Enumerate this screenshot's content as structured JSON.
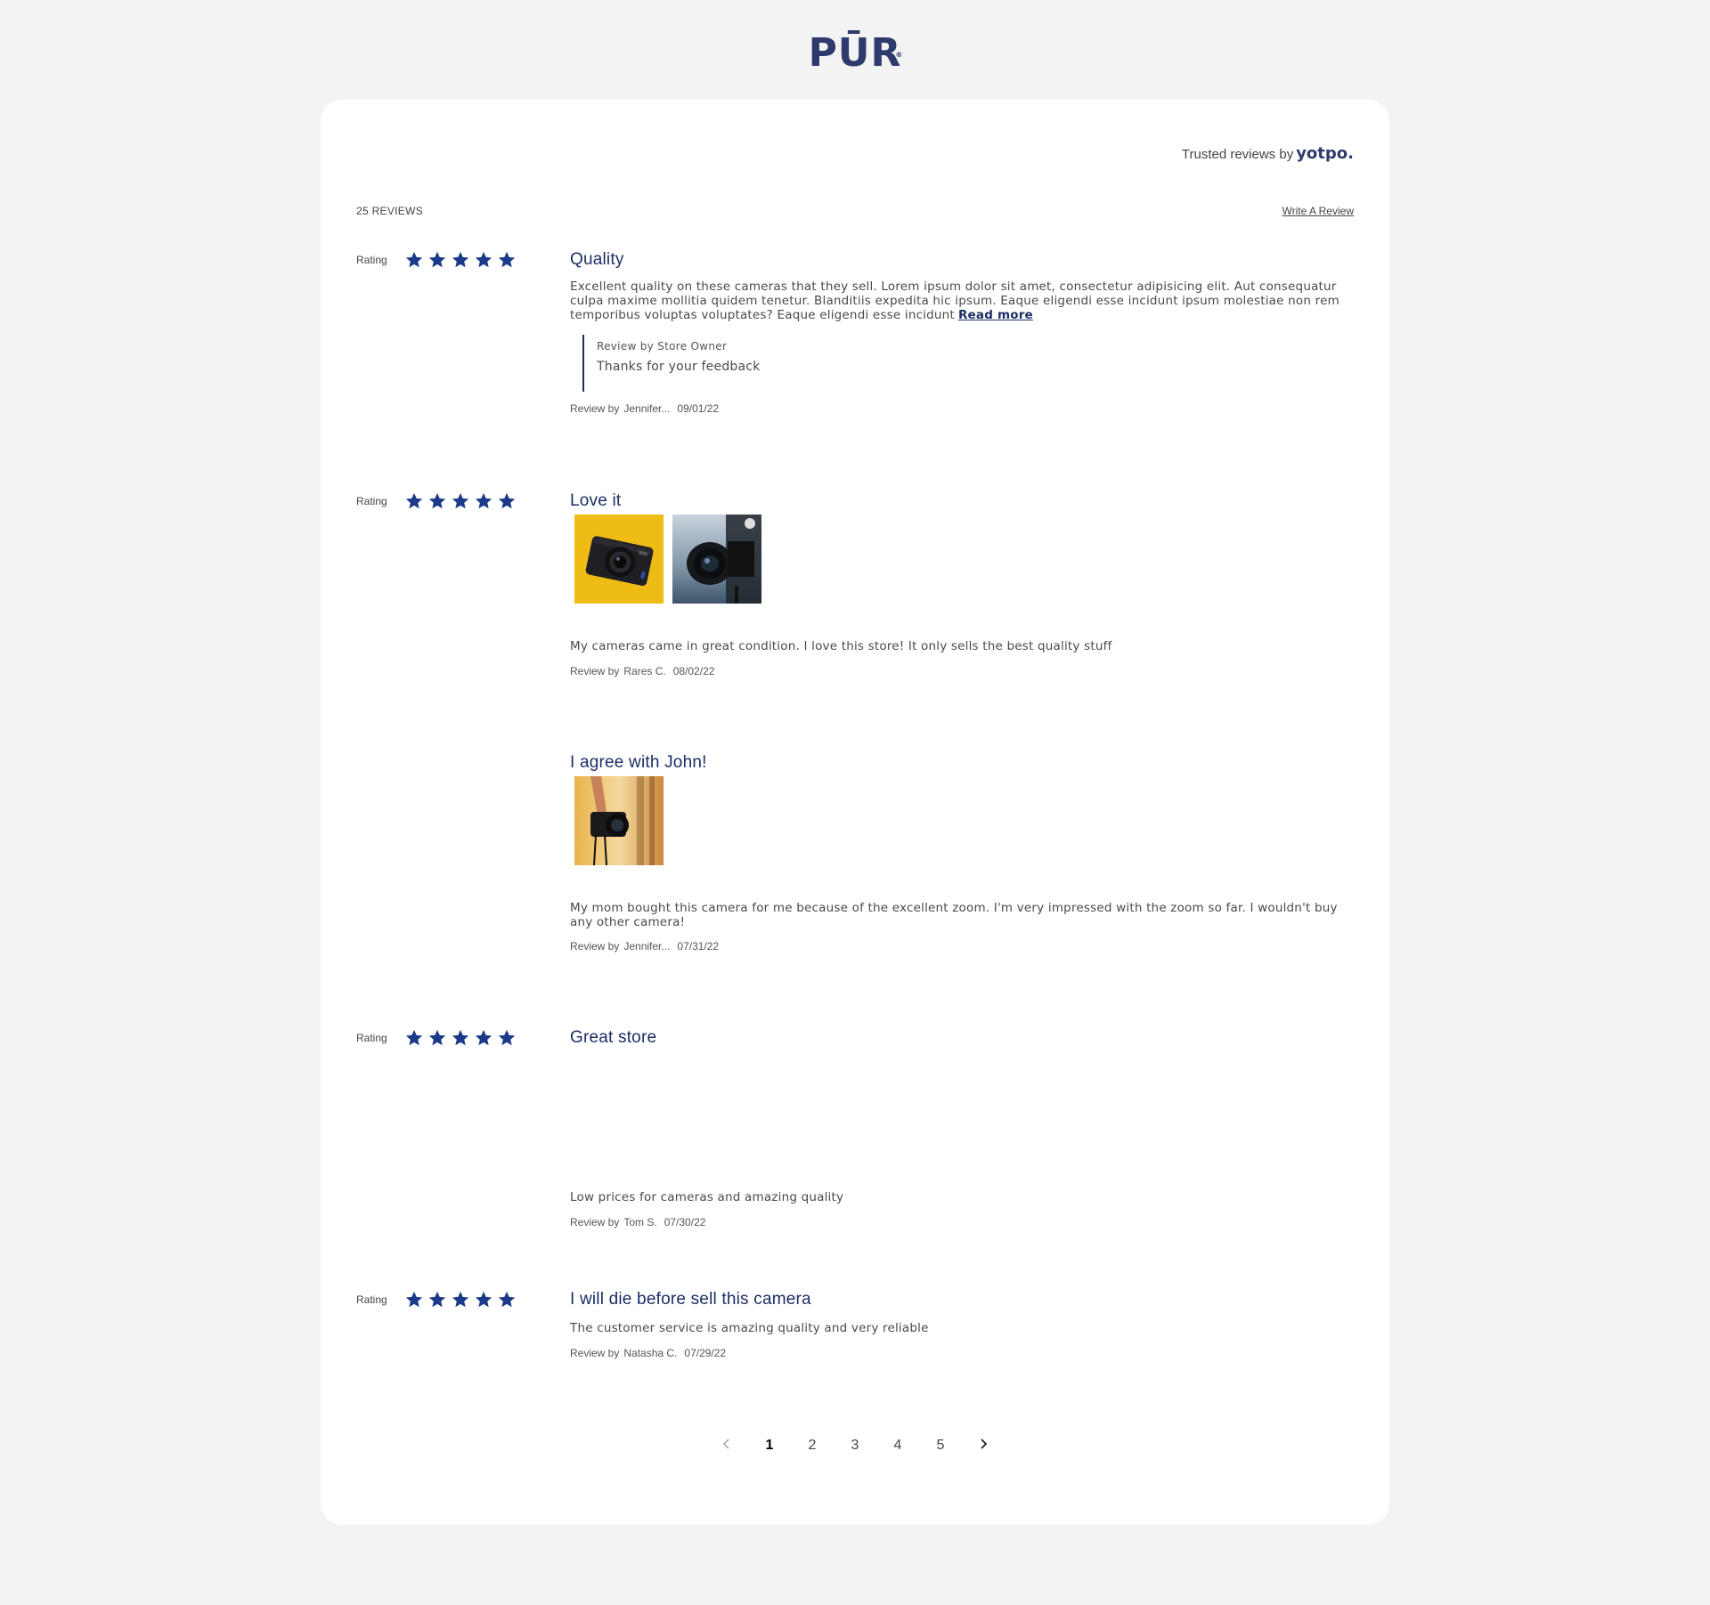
{
  "brand": {
    "logo_text": "PŪR",
    "logo_mark": "®"
  },
  "header": {
    "trusted_prefix": "Trusted reviews by",
    "trusted_brand": "yotpo.",
    "review_count": "25 REVIEWS",
    "write_review": "Write A Review"
  },
  "rating_label": "Rating",
  "accent_color": "#1c3a8a",
  "reviews": [
    {
      "stars": 5,
      "title": "Quality",
      "body": "Excellent quality on these cameras that they sell. Lorem ipsum dolor sit amet, consectetur adipisicing elit. Aut consequatur culpa maxime mollitia quidem tenetur. Blanditiis expedita hic ipsum. Eaque eligendi esse incidunt ipsum molestiae non rem temporibus voluptas voluptates?  Eaque eligendi esse incidunt",
      "read_more": "Read more",
      "reply_by": "Review by Store Owner",
      "reply_text": "Thanks for your feedback",
      "by_label": "Review by",
      "author": "Jennifer...",
      "date": "09/01/22"
    },
    {
      "stars": 5,
      "title": "Love it",
      "photos": [
        "camera-on-yellow-photo",
        "camera-lens-photo"
      ],
      "body": "My cameras came in great condition. I love this store! It only sells the best quality stuff",
      "by_label": "Review by",
      "author": "Rares C.",
      "date": "08/02/22"
    },
    {
      "title": "I agree with John!",
      "photos": [
        "hand-holding-camera-photo"
      ],
      "body": "My mom bought this camera for me because of the excellent zoom. I'm very impressed with the zoom so far. I wouldn't buy any other camera!",
      "by_label": "Review by",
      "author": "Jennifer...",
      "date": "07/31/22"
    },
    {
      "stars": 5,
      "title": "Great store",
      "body": "Low prices for cameras and amazing quality",
      "by_label": "Review by",
      "author": "Tom S.",
      "date": "07/30/22"
    },
    {
      "stars": 5,
      "title": "I will die before sell this camera",
      "body": "The customer service is amazing quality and very reliable",
      "by_label": "Review by",
      "author": "Natasha C.",
      "date": "07/29/22"
    }
  ],
  "pagination": {
    "pages": [
      "1",
      "2",
      "3",
      "4",
      "5"
    ],
    "current": "1"
  }
}
